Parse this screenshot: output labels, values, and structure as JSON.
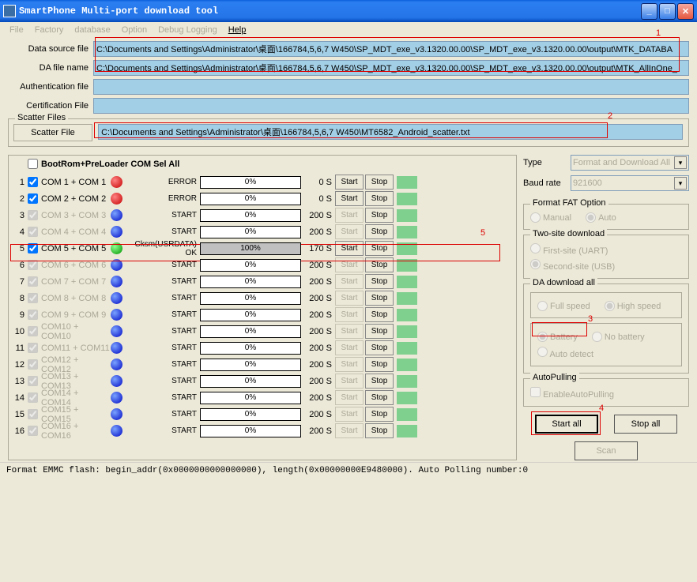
{
  "window": {
    "title": "SmartPhone Multi-port download tool"
  },
  "menu": [
    "File",
    "Factory",
    "database",
    "Option",
    "Debug Logging",
    "Help"
  ],
  "files": {
    "data_source_label": "Data source file",
    "data_source": "C:\\Documents and Settings\\Administrator\\桌面\\166784,5,6,7 W450\\SP_MDT_exe_v3.1320.00.00\\SP_MDT_exe_v3.1320.00.00\\output\\MTK_DATABA",
    "da_label": "DA file name",
    "da": "C:\\Documents and Settings\\Administrator\\桌面\\166784,5,6,7 W450\\SP_MDT_exe_v3.1320.00.00\\SP_MDT_exe_v3.1320.00.00\\output\\MTK_AllInOne_",
    "auth_label": "Authentication file",
    "auth": "",
    "cert_label": "Certification File",
    "cert": ""
  },
  "scatter": {
    "group": "Scatter Files",
    "button": "Scatter File",
    "path": "C:\\Documents and Settings\\Administrator\\桌面\\166784,5,6,7 W450\\MT6582_Android_scatter.txt"
  },
  "ports": {
    "sel_all": "BootRom+PreLoader COM Sel All",
    "start": "Start",
    "stop": "Stop",
    "rows": [
      {
        "i": "1",
        "name": "COM 1 + COM 1",
        "enabled": true,
        "dot": "red",
        "status": "ERROR",
        "pct": 0,
        "time": "0 S"
      },
      {
        "i": "2",
        "name": "COM 2 + COM 2",
        "enabled": true,
        "dot": "red",
        "status": "ERROR",
        "pct": 0,
        "time": "0 S"
      },
      {
        "i": "3",
        "name": "COM 3 + COM 3",
        "enabled": false,
        "dot": "blue",
        "status": "START",
        "pct": 0,
        "time": "200 S"
      },
      {
        "i": "4",
        "name": "COM 4 + COM 4",
        "enabled": false,
        "dot": "blue",
        "status": "START",
        "pct": 0,
        "time": "200 S"
      },
      {
        "i": "5",
        "name": "COM 5 + COM 5",
        "enabled": true,
        "dot": "green",
        "status": "Cksm(USRDATA) OK",
        "pct": 100,
        "time": "170 S"
      },
      {
        "i": "6",
        "name": "COM 6 + COM 6",
        "enabled": false,
        "dot": "blue",
        "status": "START",
        "pct": 0,
        "time": "200 S"
      },
      {
        "i": "7",
        "name": "COM 7 + COM 7",
        "enabled": false,
        "dot": "blue",
        "status": "START",
        "pct": 0,
        "time": "200 S"
      },
      {
        "i": "8",
        "name": "COM 8 + COM 8",
        "enabled": false,
        "dot": "blue",
        "status": "START",
        "pct": 0,
        "time": "200 S"
      },
      {
        "i": "9",
        "name": "COM 9 + COM 9",
        "enabled": false,
        "dot": "blue",
        "status": "START",
        "pct": 0,
        "time": "200 S"
      },
      {
        "i": "10",
        "name": "COM10 + COM10",
        "enabled": false,
        "dot": "blue",
        "status": "START",
        "pct": 0,
        "time": "200 S"
      },
      {
        "i": "11",
        "name": "COM11 + COM11",
        "enabled": false,
        "dot": "blue",
        "status": "START",
        "pct": 0,
        "time": "200 S"
      },
      {
        "i": "12",
        "name": "COM12 + COM12",
        "enabled": false,
        "dot": "blue",
        "status": "START",
        "pct": 0,
        "time": "200 S"
      },
      {
        "i": "13",
        "name": "COM13 + COM13",
        "enabled": false,
        "dot": "blue",
        "status": "START",
        "pct": 0,
        "time": "200 S"
      },
      {
        "i": "14",
        "name": "COM14 + COM14",
        "enabled": false,
        "dot": "blue",
        "status": "START",
        "pct": 0,
        "time": "200 S"
      },
      {
        "i": "15",
        "name": "COM15 + COM15",
        "enabled": false,
        "dot": "blue",
        "status": "START",
        "pct": 0,
        "time": "200 S"
      },
      {
        "i": "16",
        "name": "COM16 + COM16",
        "enabled": false,
        "dot": "blue",
        "status": "START",
        "pct": 0,
        "time": "200 S"
      }
    ]
  },
  "side": {
    "type_label": "Type",
    "type_value": "Format and Download All",
    "baud_label": "Baud rate",
    "baud_value": "921600",
    "fat_group": "Format FAT Option",
    "fat_manual": "Manual",
    "fat_auto": "Auto",
    "two_group": "Two-site download",
    "first_site": "First-site (UART)",
    "second_site": "Second-site (USB)",
    "da_group": "DA download all",
    "full_speed": "Full speed",
    "high_speed": "High speed",
    "battery": "Battery",
    "no_battery": "No battery",
    "auto_detect": "Auto detect",
    "pull_group": "AutoPulling",
    "enable_pull": "EnableAutoPulling",
    "start_all": "Start all",
    "stop_all": "Stop all",
    "scan": "Scan"
  },
  "bottom": "Format EMMC flash:  begin_addr(0x0000000000000000), length(0x00000000E9480000).  Auto Polling number:0",
  "annot": {
    "a1": "1",
    "a2": "2",
    "a3": "3",
    "a4": "4",
    "a5": "5"
  }
}
